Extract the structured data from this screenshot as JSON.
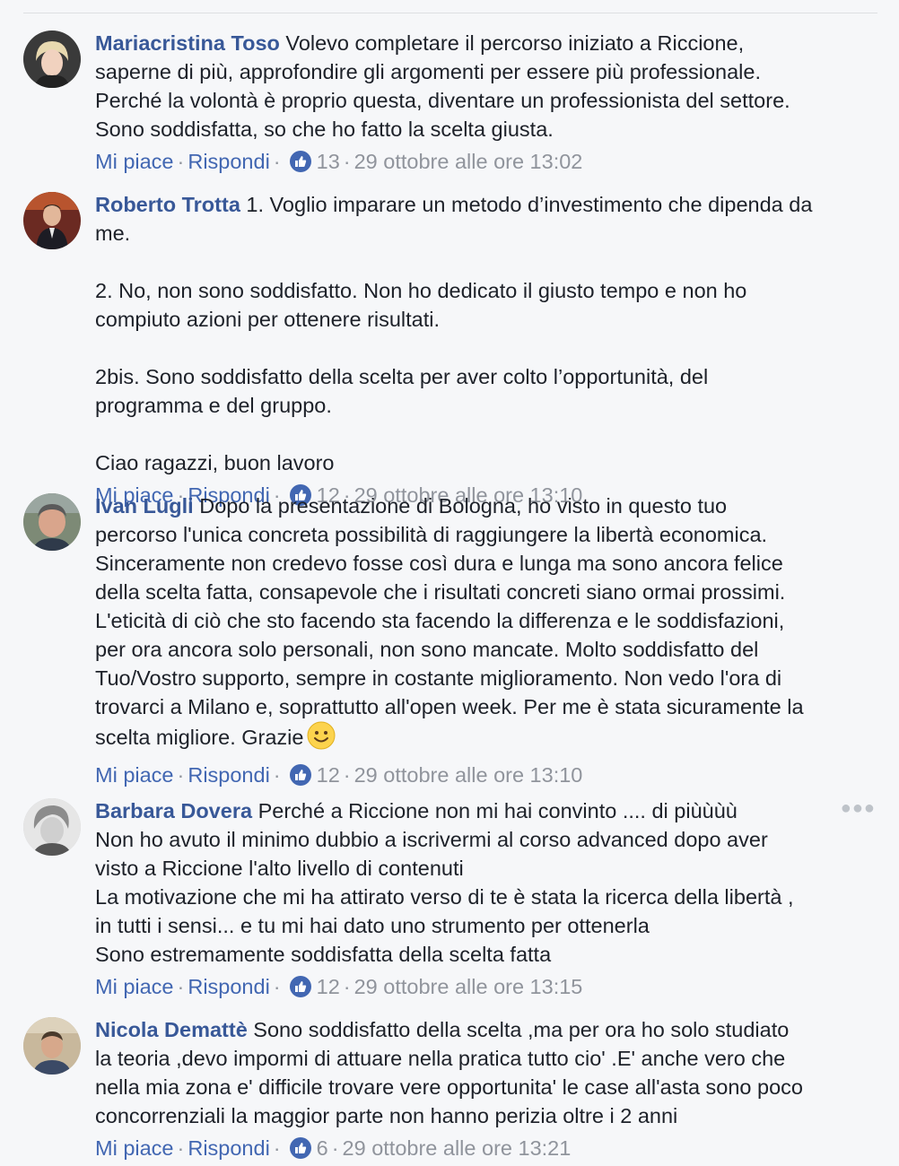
{
  "comments": [
    {
      "author": "Mariacristina Toso",
      "text": " Volevo completare il percorso iniziato a Riccione,\nsaperne di più, approfondire gli argomenti per essere più professionale.\nPerché la volontà è proprio questa, diventare un professionista del settore.\nSono soddisfatta, so che ho fatto la scelta giusta.",
      "like_label": "Mi piace",
      "reply_label": "Rispondi",
      "likes": "13",
      "timestamp": "29 ottobre alle ore 13:02"
    },
    {
      "author": "Roberto Trotta",
      "text": " 1. Voglio imparare un metodo d’investimento che dipenda da\nme.\n\n2. No, non sono soddisfatto. Non ho dedicato il giusto tempo e non ho\ncompiuto azioni per ottenere risultati.\n\n2bis. Sono soddisfatto della scelta per aver colto l’opportunità, del\nprogramma e del gruppo.\n\nCiao ragazzi, buon lavoro",
      "like_label": "Mi piace",
      "reply_label": "Rispondi",
      "likes": "12",
      "timestamp": "29 ottobre alle ore 13:10"
    },
    {
      "author": "Ivan Lugli",
      "text": " Dopo la presentazione di Bologna, ho visto in questo tuo\npercorso l'unica concreta possibilità di raggiungere la libertà economica.\nSinceramente non credevo fosse così dura e lunga ma sono ancora felice\ndella scelta fatta, consapevole che i risultati concreti siano ormai prossimi.\nL'eticità di ciò che sto facendo sta facendo la differenza e le soddisfazioni,\nper ora ancora solo personali, non sono mancate. Molto soddisfatto del\nTuo/Vostro supporto, sempre in costante miglioramento. Non vedo l'ora di\ntrovarci a Milano e, soprattutto all'open week. Per me è stata sicuramente la\nscelta migliore. Grazie",
      "like_label": "Mi piace",
      "reply_label": "Rispondi",
      "likes": "12",
      "timestamp": "29 ottobre alle ore 13:10"
    },
    {
      "author": "Barbara Dovera",
      "text": " Perché a Riccione non mi hai convinto .... di piùùùù\nNon ho avuto il minimo dubbio a iscrivermi al corso advanced dopo aver\nvisto a Riccione l'alto livello di contenuti\nLa motivazione che mi ha attirato verso di te è stata la ricerca della libertà ,\nin tutti i sensi... e tu mi hai dato uno strumento per ottenerla\nSono estremamente soddisfatta della scelta fatta",
      "like_label": "Mi piace",
      "reply_label": "Rispondi",
      "likes": "12",
      "timestamp": "29 ottobre alle ore 13:15"
    },
    {
      "author": "Nicola Demattè",
      "text": " Sono soddisfatto della scelta ,ma per ora ho solo studiato\nla teoria ,devo impormi di attuare nella pratica tutto cio' .E' anche vero che\nnella mia zona e' difficile trovare vere opportunita' le case all'asta sono poco\nconcorrenziali la maggior parte non hanno perizia oltre i 2 anni",
      "like_label": "Mi piace",
      "reply_label": "Rispondi",
      "likes": "6",
      "timestamp": "29 ottobre alle ore 13:21"
    }
  ],
  "separator": "·",
  "icons": {
    "like_badge": "thumbs-up-icon",
    "emoji": "smiley-icon",
    "more": "more-options-icon"
  },
  "colors": {
    "link": "#4267b2",
    "author": "#385898",
    "meta": "#90949c",
    "background": "#f6f7f9"
  }
}
